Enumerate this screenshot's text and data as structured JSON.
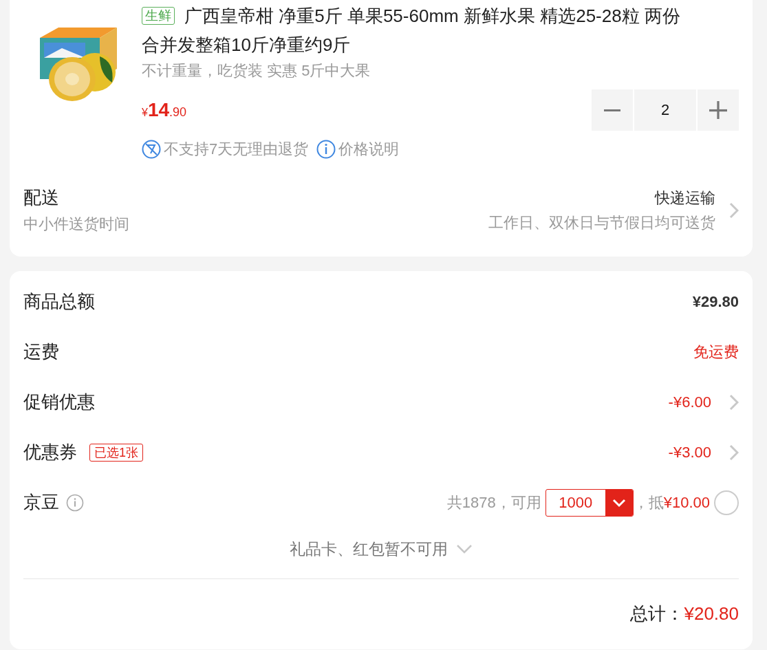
{
  "product": {
    "tag": "生鲜",
    "title_lines": [
      "广西皇帝柑 净重5斤 单果55-60mm 新鲜水果 精选25-28粒 两份",
      "合并发整箱10斤净重约9斤"
    ],
    "subtitle": "不计重量，吃货装 实惠 5斤中大果",
    "price": {
      "currency": "¥",
      "integer": "14",
      "fraction": ".90"
    },
    "quantity": "2",
    "services": [
      {
        "kind": "no-return",
        "text": "不支持7天无理由退货"
      },
      {
        "kind": "info",
        "text": "价格说明"
      }
    ]
  },
  "delivery": {
    "label": "配送",
    "note": "中小件送货时间",
    "method": "快递运输",
    "time": "工作日、双休日与节假日均可送货"
  },
  "summary": [
    {
      "label": "商品总额",
      "value": "¥29.80",
      "highlight": false,
      "link": false
    },
    {
      "label": "运费",
      "value": "免运费",
      "highlight": true,
      "link": false
    },
    {
      "label": "促销优惠",
      "value": "-¥6.00",
      "highlight": true,
      "link": true
    },
    {
      "label": "优惠券",
      "badge": "已选1张",
      "value": "-¥3.00",
      "highlight": true,
      "link": true
    }
  ],
  "beans": {
    "label": "京豆",
    "available": "共1878，可用",
    "amount": "1000",
    "deduct_prefix": "，抵",
    "deduct": "¥10.00",
    "checked": false
  },
  "unavailable_note": "礼品卡、红包暂不可用",
  "total": {
    "label": "总计：",
    "value": "¥20.80"
  }
}
